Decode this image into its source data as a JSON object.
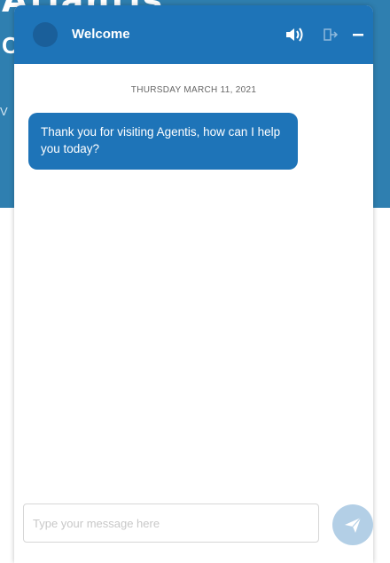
{
  "background": {
    "heading": "Atlantis",
    "sub": "C",
    "side": "V"
  },
  "chat": {
    "header": {
      "title": "Welcome",
      "icons": [
        "avatar",
        "speaker-icon",
        "exit-icon",
        "minimize-icon"
      ]
    },
    "date_separator": "THURSDAY MARCH 11, 2021",
    "messages": [
      {
        "sender": "agent",
        "text": "Thank you for visiting Agentis, how can I help you today?"
      }
    ],
    "input": {
      "placeholder": "Type your message here",
      "value": ""
    },
    "send_icon": "send-icon"
  },
  "colors": {
    "brand": "#1e74b8",
    "banner": "#2f7fb0",
    "send_disabled": "#b3cfe6"
  }
}
